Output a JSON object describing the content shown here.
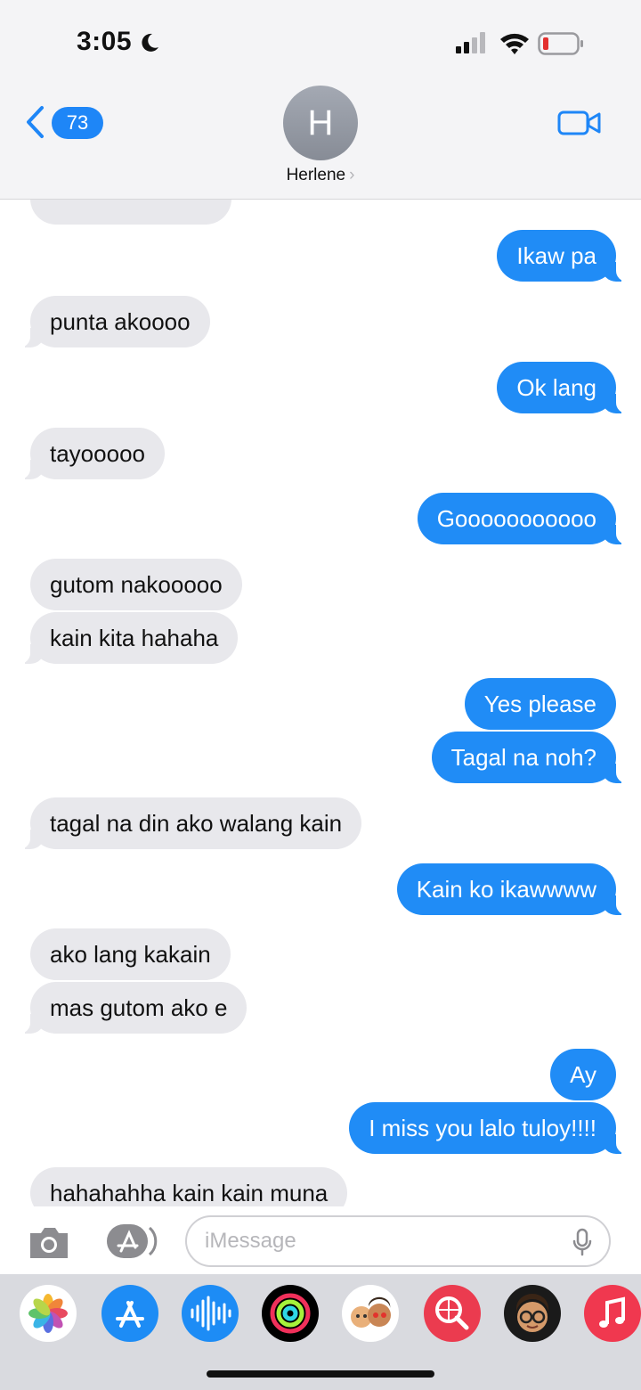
{
  "status_bar": {
    "time": "3:05"
  },
  "header": {
    "back_badge": "73",
    "avatar_initial": "H",
    "contact_name": "Herlene",
    "chevron": "›"
  },
  "messages": [
    {
      "side": "out",
      "text": "Ikaw pa"
    },
    {
      "side": "in",
      "text": "punta akoooo"
    },
    {
      "side": "out",
      "text": "Ok lang"
    },
    {
      "side": "in",
      "text": "tayooooo"
    },
    {
      "side": "out",
      "text": "Gooooooooooo"
    },
    {
      "side": "in",
      "text": "gutom nakooooo"
    },
    {
      "side": "in",
      "text": "kain kita hahaha"
    },
    {
      "side": "out",
      "text": "Yes please"
    },
    {
      "side": "out",
      "text": "Tagal na noh?"
    },
    {
      "side": "in",
      "text": "tagal na din ako walang kain"
    },
    {
      "side": "out",
      "text": "Kain ko ikawwww"
    },
    {
      "side": "in",
      "text": "ako lang kakain"
    },
    {
      "side": "in",
      "text": "mas gutom ako e"
    },
    {
      "side": "out",
      "text": "Ay"
    },
    {
      "side": "out",
      "text": "I miss you lalo tuloy!!!!"
    },
    {
      "side": "in",
      "text": "hahahahha kain kain muna"
    }
  ],
  "input": {
    "placeholder": "iMessage"
  },
  "app_drawer": {
    "apps": [
      "photos-icon",
      "app-store-icon",
      "audio-message-icon",
      "activity-icon",
      "memoji-stickers-icon",
      "search-images-icon",
      "memoji-icon",
      "music-icon"
    ]
  },
  "colors": {
    "outgoing": "#208cf6",
    "incoming": "#e8e8ec",
    "accent": "#1e86f7"
  }
}
